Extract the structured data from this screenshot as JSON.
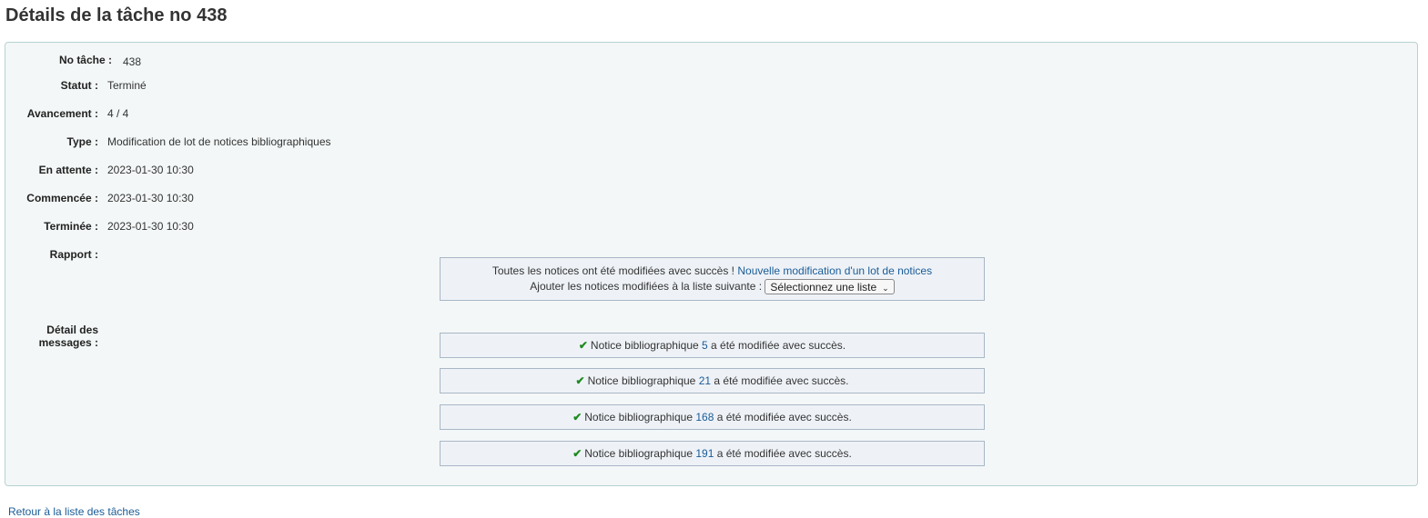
{
  "page": {
    "title": "Détails de la tâche no 438"
  },
  "details": {
    "id_label": "No tâche :",
    "id_value": "438",
    "status_label": "Statut :",
    "status_value": "Terminé",
    "progress_label": "Avancement :",
    "progress_value": "4 / 4",
    "type_label": "Type :",
    "type_value": "Modification de lot de notices bibliographiques",
    "enqueued_label": "En attente :",
    "enqueued_value": "2023-01-30 10:30",
    "started_label": "Commencée :",
    "started_value": "2023-01-30 10:30",
    "ended_label": "Terminée :",
    "ended_value": "2023-01-30 10:30",
    "report_label": "Rapport :",
    "messages_label_line1": "Détail des",
    "messages_label_line2": "messages :"
  },
  "report": {
    "success_text": "Toutes les notices ont été modifiées avec succès ! ",
    "new_batch_link": "Nouvelle modification d'un lot de notices",
    "add_to_list_text": "Ajouter les notices modifiées à la liste suivante : ",
    "list_select_value": "Sélectionnez une liste"
  },
  "messages": [
    {
      "prefix": "Notice bibliographique ",
      "record": "5",
      "suffix": " a été modifiée avec succès."
    },
    {
      "prefix": "Notice bibliographique ",
      "record": "21",
      "suffix": " a été modifiée avec succès."
    },
    {
      "prefix": "Notice bibliographique ",
      "record": "168",
      "suffix": " a été modifiée avec succès."
    },
    {
      "prefix": "Notice bibliographique ",
      "record": "191",
      "suffix": " a été modifiée avec succès."
    }
  ],
  "footer": {
    "back_link": "Retour à la liste des tâches"
  },
  "colors": {
    "link": "#1a5c96",
    "check": "#1e8a1e",
    "panel_bg": "#f3f7f7"
  }
}
